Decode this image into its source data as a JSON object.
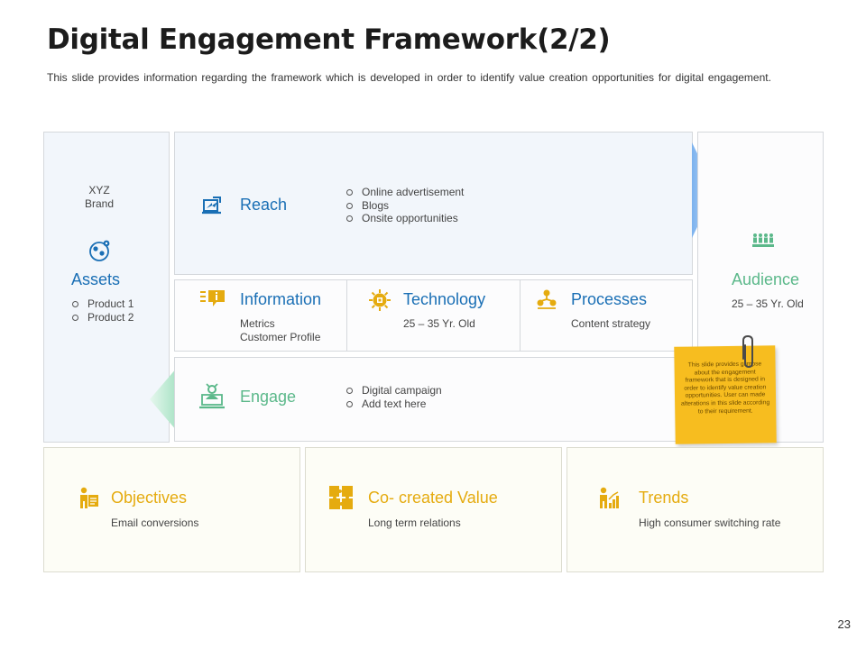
{
  "title": "Digital Engagement Framework(2/2)",
  "subtitle": "This slide provides information regarding the framework which is developed in order to identify value creation opportunities for digital engagement.",
  "colors": {
    "blue_heading": "#1a6fb5",
    "green_heading": "#5bb88a",
    "yellow_heading": "#e5ab0f",
    "note_yellow": "#f7bd1f"
  },
  "assets": {
    "brand_line1": "XYZ",
    "brand_line2": "Brand",
    "icon": "people-network-icon",
    "heading": "Assets",
    "items": [
      "Product 1",
      "Product 2"
    ]
  },
  "reach": {
    "icon": "laptop-share-icon",
    "heading": "Reach",
    "items": [
      "Online advertisement",
      "Blogs",
      "Onsite opportunities"
    ]
  },
  "information": {
    "icon": "info-chat-icon",
    "heading": "Information",
    "line1": "Metrics",
    "line2": "Customer Profile"
  },
  "technology": {
    "icon": "gear-chip-icon",
    "heading": "Technology",
    "text": "25 – 35 Yr. Old"
  },
  "processes": {
    "icon": "process-nodes-icon",
    "heading": "Processes",
    "text": "Content strategy"
  },
  "engage": {
    "icon": "laptop-person-icon",
    "heading": "Engage",
    "items": [
      "Digital campaign",
      "Add text here"
    ]
  },
  "audience": {
    "icon": "crowd-icon",
    "heading": "Audience",
    "text": "25 – 35 Yr. Old"
  },
  "sticky_note": {
    "text": "This slide provides glimpse about the engagement framework that is designed in order to identify value creation opportunities. User can made alterations in this slide according to their requirement."
  },
  "objectives": {
    "icon": "person-clipboard-icon",
    "heading": "Objectives",
    "text": "Email conversions"
  },
  "co_created_value": {
    "icon": "puzzle-icon",
    "heading": "Co- created Value",
    "text": "Long term relations"
  },
  "trends": {
    "icon": "person-chart-icon",
    "heading": "Trends",
    "text": "High consumer switching rate"
  },
  "page_number": "23"
}
